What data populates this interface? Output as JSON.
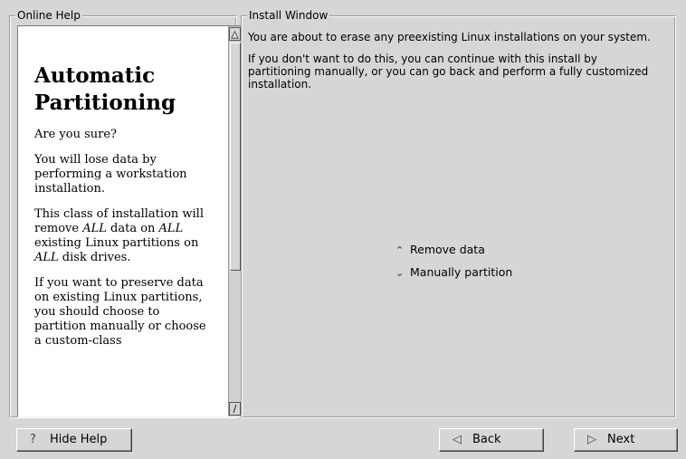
{
  "help_panel": {
    "title": "Online Help",
    "heading_line1": "Automatic",
    "heading_line2": "Partitioning",
    "paragraphs": [
      "Are you sure?",
      "You will lose data by performing a workstation installation.",
      "This class of installation will remove ALL data on ALL existing Linux partitions on ALL disk drives.",
      "If you want to preserve data on existing Linux partitions, you should choose to partition manually or choose a custom-class"
    ],
    "scroll_up_glyph": "△",
    "scroll_down_glyph": "∕"
  },
  "install_window": {
    "title": "Install Window",
    "paragraph1": "You are about to erase any preexisting Linux installations on your system.",
    "paragraph2": "If you don't want to do this, you can continue with this install by partitioning manually, or you can go back and perform a fully customized installation.",
    "options": [
      {
        "label": "Remove data",
        "selected": true,
        "glyph": "⌃"
      },
      {
        "label": "Manually partition",
        "selected": false,
        "glyph": "⌄"
      }
    ]
  },
  "buttons": {
    "hide_help": "Hide Help",
    "hide_help_icon": "?",
    "back": "Back",
    "back_icon": "◁",
    "next": "Next",
    "next_icon": "▷"
  }
}
